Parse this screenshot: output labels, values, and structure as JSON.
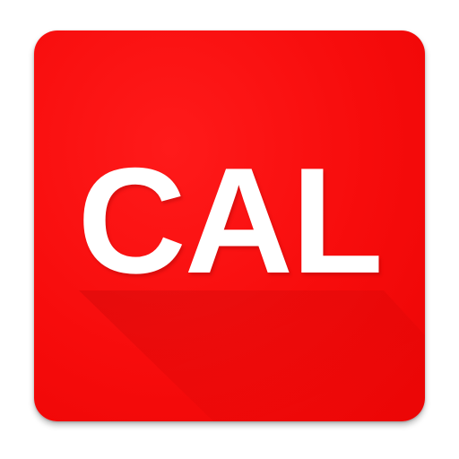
{
  "icon": {
    "label": "CAL",
    "background_color": "#f70c0c",
    "text_color": "#ffffff"
  }
}
